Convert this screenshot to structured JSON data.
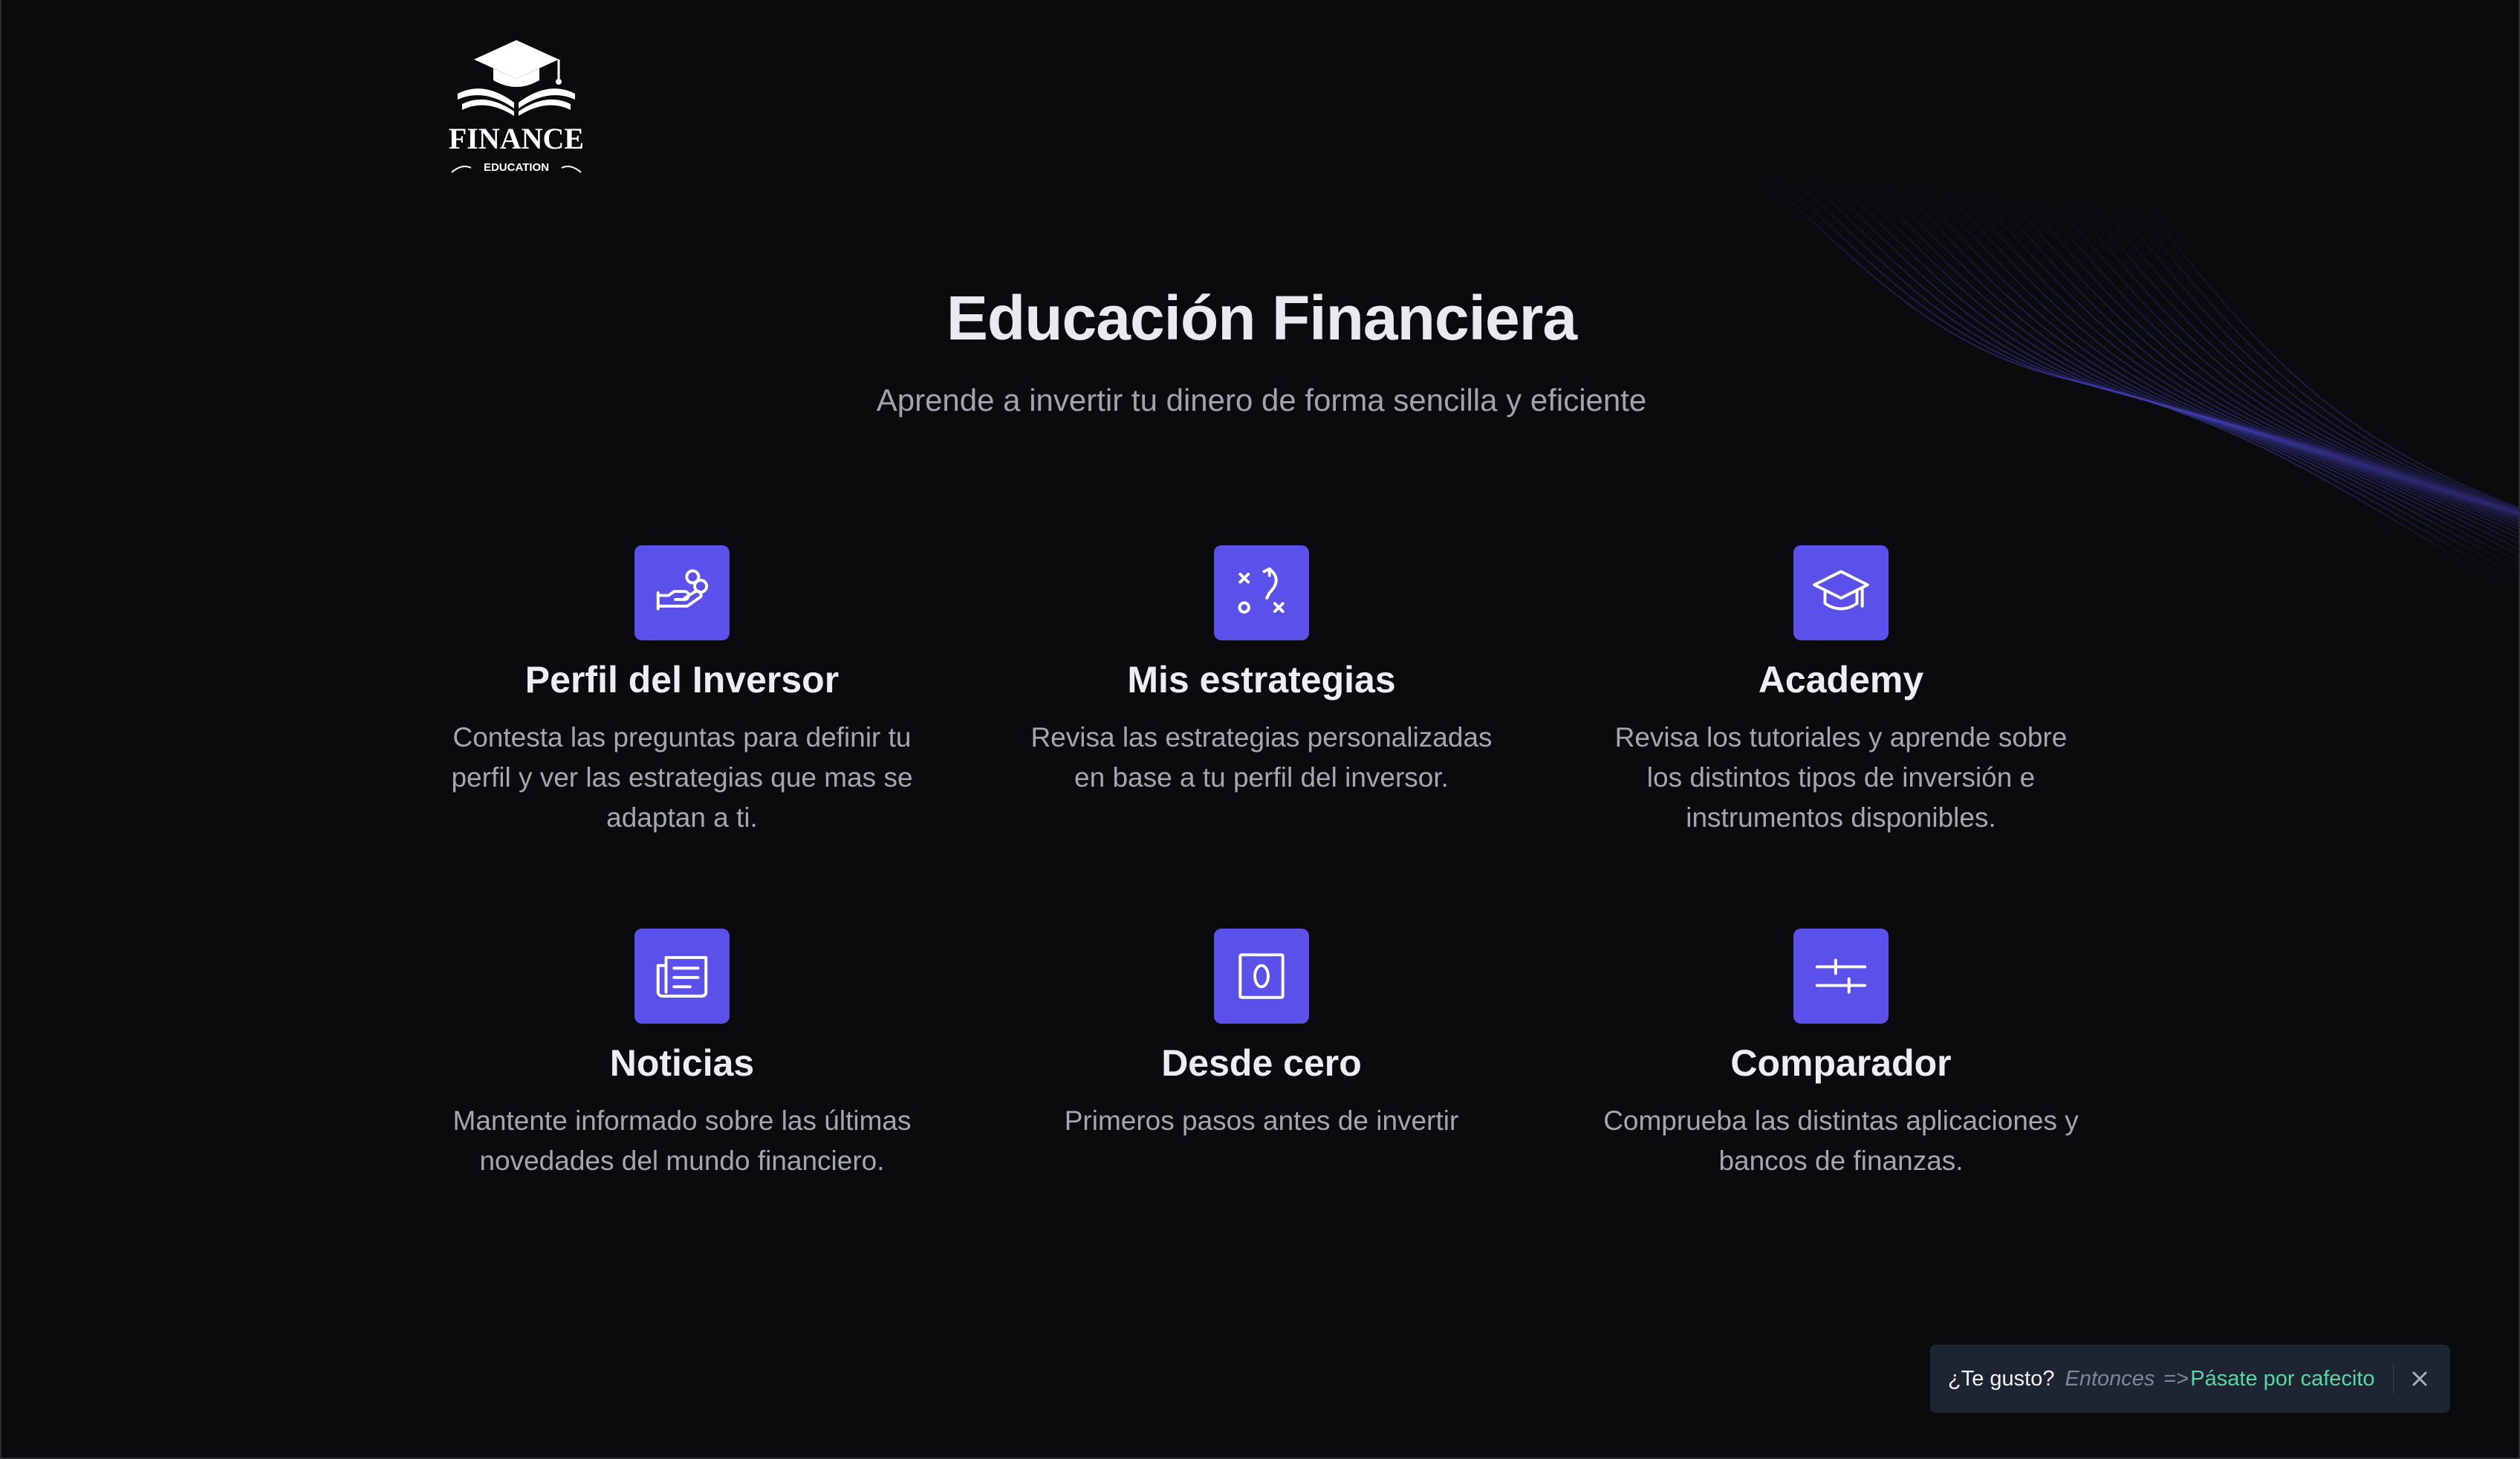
{
  "brand": {
    "logo_name": "FINANCE",
    "logo_tagline": "EDUCATION"
  },
  "hero": {
    "title": "Educación Financiera",
    "subtitle": "Aprende a invertir tu dinero de forma sencilla y eficiente"
  },
  "features": [
    {
      "icon": "hand-coins-icon",
      "title": "Perfil del Inversor",
      "description": "Contesta las preguntas para definir tu perfil y ver las estrategias que mas se adaptan a ti."
    },
    {
      "icon": "strategy-icon",
      "title": "Mis estrategias",
      "description": "Revisa las estrategias personalizadas en base a tu perfil del inversor."
    },
    {
      "icon": "graduation-cap-icon",
      "title": "Academy",
      "description": "Revisa los tutoriales y aprende sobre los distintos tipos de inversión e instrumentos disponibles."
    },
    {
      "icon": "newspaper-icon",
      "title": "Noticias",
      "description": "Mantente informado sobre las últimas novedades del mundo financiero."
    },
    {
      "icon": "zero-box-icon",
      "title": "Desde cero",
      "description": "Primeros pasos antes de invertir"
    },
    {
      "icon": "sliders-icon",
      "title": "Comparador",
      "description": "Comprueba las distintas aplicaciones y bancos de finanzas."
    }
  ],
  "toast": {
    "question": "¿Te gusto?",
    "then": "Entonces",
    "arrow": "=>",
    "link": "Pásate por cafecito"
  },
  "colors": {
    "background": "#0b0b0e",
    "accent": "#5a50ea",
    "link": "#58d8a4",
    "toast_bg": "#1d2432"
  }
}
